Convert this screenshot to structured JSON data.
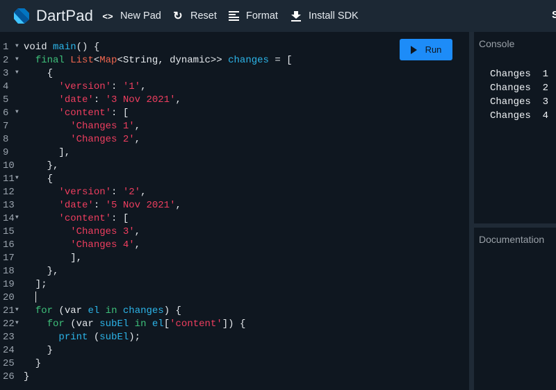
{
  "header": {
    "brand": "DartPad",
    "buttons": [
      {
        "label": "New Pad",
        "icon": "code-brackets-icon"
      },
      {
        "label": "Reset",
        "icon": "refresh-icon"
      },
      {
        "label": "Format",
        "icon": "format-lines-icon"
      },
      {
        "label": "Install SDK",
        "icon": "download-icon"
      }
    ],
    "clipped_text": "S"
  },
  "editor": {
    "run_label": "Run",
    "lines": [
      {
        "n": "1",
        "fold": true
      },
      {
        "n": "2",
        "fold": true
      },
      {
        "n": "3",
        "fold": true
      },
      {
        "n": "4",
        "fold": false
      },
      {
        "n": "5",
        "fold": false
      },
      {
        "n": "6",
        "fold": true
      },
      {
        "n": "7",
        "fold": false
      },
      {
        "n": "8",
        "fold": false
      },
      {
        "n": "9",
        "fold": false
      },
      {
        "n": "10",
        "fold": false
      },
      {
        "n": "11",
        "fold": true
      },
      {
        "n": "12",
        "fold": false
      },
      {
        "n": "13",
        "fold": false
      },
      {
        "n": "14",
        "fold": true
      },
      {
        "n": "15",
        "fold": false
      },
      {
        "n": "16",
        "fold": false
      },
      {
        "n": "17",
        "fold": false
      },
      {
        "n": "18",
        "fold": false
      },
      {
        "n": "19",
        "fold": false
      },
      {
        "n": "20",
        "fold": false
      },
      {
        "n": "21",
        "fold": true
      },
      {
        "n": "22",
        "fold": true
      },
      {
        "n": "23",
        "fold": false
      },
      {
        "n": "24",
        "fold": false
      },
      {
        "n": "25",
        "fold": false
      },
      {
        "n": "26",
        "fold": false
      }
    ],
    "code": [
      [
        [
          "txt",
          "void "
        ],
        [
          "fn",
          "main"
        ],
        [
          "txt",
          "() {"
        ]
      ],
      [
        [
          "txt",
          "  "
        ],
        [
          "kw",
          "final "
        ],
        [
          "ty",
          "List"
        ],
        [
          "txt",
          "<"
        ],
        [
          "ty",
          "Map"
        ],
        [
          "txt",
          "<String, dynamic>> "
        ],
        [
          "fn",
          "changes"
        ],
        [
          "txt",
          " = ["
        ]
      ],
      [
        [
          "txt",
          "    {"
        ]
      ],
      [
        [
          "txt",
          "      "
        ],
        [
          "str",
          "'version'"
        ],
        [
          "txt",
          ": "
        ],
        [
          "str",
          "'1'"
        ],
        [
          "txt",
          ","
        ]
      ],
      [
        [
          "txt",
          "      "
        ],
        [
          "str",
          "'date'"
        ],
        [
          "txt",
          ": "
        ],
        [
          "str",
          "'3 Nov 2021'"
        ],
        [
          "txt",
          ","
        ]
      ],
      [
        [
          "txt",
          "      "
        ],
        [
          "str",
          "'content'"
        ],
        [
          "txt",
          ": ["
        ]
      ],
      [
        [
          "txt",
          "        "
        ],
        [
          "str",
          "'Changes 1'"
        ],
        [
          "txt",
          ","
        ]
      ],
      [
        [
          "txt",
          "        "
        ],
        [
          "str",
          "'Changes 2'"
        ],
        [
          "txt",
          ","
        ]
      ],
      [
        [
          "txt",
          "      ],"
        ]
      ],
      [
        [
          "txt",
          "    },"
        ]
      ],
      [
        [
          "txt",
          "    {"
        ]
      ],
      [
        [
          "txt",
          "      "
        ],
        [
          "str",
          "'version'"
        ],
        [
          "txt",
          ": "
        ],
        [
          "str",
          "'2'"
        ],
        [
          "txt",
          ","
        ]
      ],
      [
        [
          "txt",
          "      "
        ],
        [
          "str",
          "'date'"
        ],
        [
          "txt",
          ": "
        ],
        [
          "str",
          "'5 Nov 2021'"
        ],
        [
          "txt",
          ","
        ]
      ],
      [
        [
          "txt",
          "      "
        ],
        [
          "str",
          "'content'"
        ],
        [
          "txt",
          ": ["
        ]
      ],
      [
        [
          "txt",
          "        "
        ],
        [
          "str",
          "'Changes 3'"
        ],
        [
          "txt",
          ","
        ]
      ],
      [
        [
          "txt",
          "        "
        ],
        [
          "str",
          "'Changes 4'"
        ],
        [
          "txt",
          ","
        ]
      ],
      [
        [
          "txt",
          "        ],"
        ]
      ],
      [
        [
          "txt",
          "    },"
        ]
      ],
      [
        [
          "txt",
          "  ];"
        ]
      ],
      [
        [
          "txt",
          "  "
        ],
        [
          "cursor",
          ""
        ]
      ],
      [
        [
          "txt",
          "  "
        ],
        [
          "kw",
          "for"
        ],
        [
          "txt",
          " (var "
        ],
        [
          "fn",
          "el"
        ],
        [
          "txt",
          " "
        ],
        [
          "kw",
          "in"
        ],
        [
          "txt",
          " "
        ],
        [
          "fn",
          "changes"
        ],
        [
          "txt",
          ") {"
        ]
      ],
      [
        [
          "txt",
          "    "
        ],
        [
          "kw",
          "for"
        ],
        [
          "txt",
          " (var "
        ],
        [
          "fn",
          "subEl"
        ],
        [
          "txt",
          " "
        ],
        [
          "kw",
          "in"
        ],
        [
          "txt",
          " "
        ],
        [
          "fn",
          "el"
        ],
        [
          "txt",
          "["
        ],
        [
          "str",
          "'content'"
        ],
        [
          "txt",
          "]) {"
        ]
      ],
      [
        [
          "txt",
          "      "
        ],
        [
          "fn",
          "print"
        ],
        [
          "txt",
          " ("
        ],
        [
          "fn",
          "subEl"
        ],
        [
          "txt",
          ");"
        ]
      ],
      [
        [
          "txt",
          "    }"
        ]
      ],
      [
        [
          "txt",
          "  }"
        ]
      ],
      [
        [
          "txt",
          "}"
        ]
      ]
    ]
  },
  "console": {
    "title": "Console",
    "output": [
      "Changes 1",
      "Changes 2",
      "Changes 3",
      "Changes 4"
    ]
  },
  "documentation": {
    "title": "Documentation"
  },
  "colors": {
    "accent": "#1d8cf8",
    "header_bg": "#1c2834",
    "editor_bg": "#0f1720",
    "keyword": "#3ec07a",
    "type": "#f0664f",
    "identifier": "#2cb4e8",
    "string": "#ef3e5f"
  }
}
